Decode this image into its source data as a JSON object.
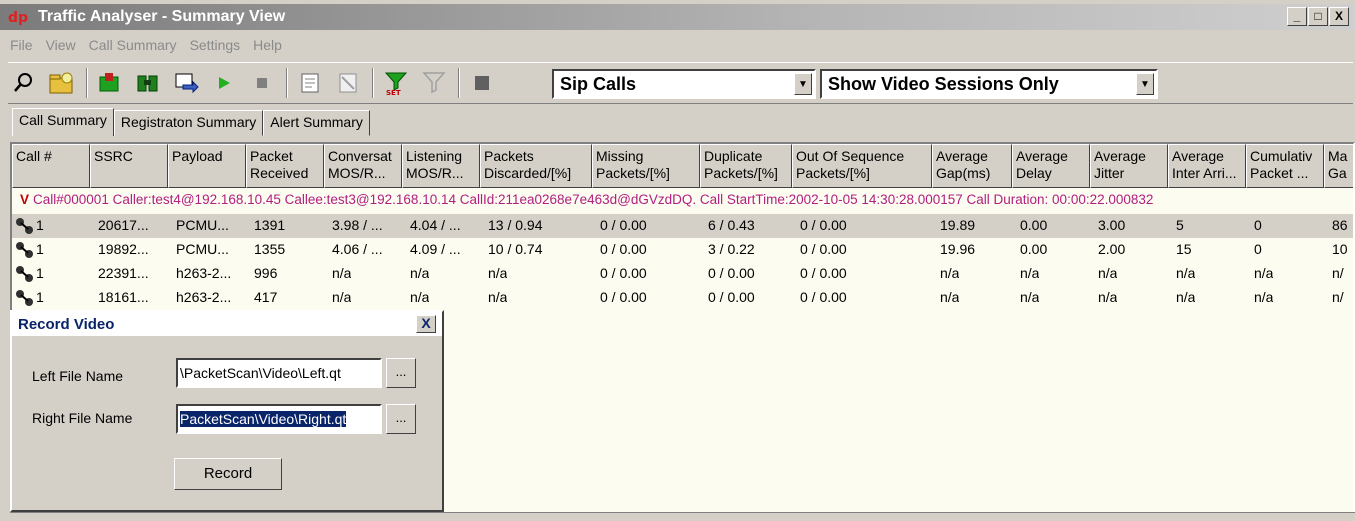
{
  "window": {
    "title": "Traffic Analyser - Summary View",
    "controls": [
      "_",
      "□",
      "X"
    ]
  },
  "menu": [
    "File",
    "View",
    "Call Summary",
    "Settings",
    "Help"
  ],
  "toolbar": {
    "icons": [
      "search-icon",
      "folder-icon",
      "add-icon",
      "binoculars-icon",
      "export-icon",
      "play-icon",
      "stop-icon",
      "report-icon",
      "clear-icon",
      "set-filter-icon",
      "filter-icon",
      "stop-capture-icon"
    ],
    "call_type": "Sip Calls",
    "session_filter": "Show Video Sessions Only"
  },
  "tabs": [
    "Call Summary",
    "Registraton Summary",
    "Alert Summary"
  ],
  "columns": [
    {
      "l1": "Call #",
      "l2": ""
    },
    {
      "l1": "SSRC",
      "l2": ""
    },
    {
      "l1": "Payload",
      "l2": ""
    },
    {
      "l1": "Packet",
      "l2": "Received"
    },
    {
      "l1": "Conversat",
      "l2": "MOS/R..."
    },
    {
      "l1": "Listening",
      "l2": "MOS/R..."
    },
    {
      "l1": "Packets",
      "l2": "Discarded/[%]"
    },
    {
      "l1": "Missing",
      "l2": "Packets/[%]"
    },
    {
      "l1": "Duplicate",
      "l2": "Packets/[%]"
    },
    {
      "l1": "Out Of Sequence",
      "l2": "Packets/[%]"
    },
    {
      "l1": "Average",
      "l2": "Gap(ms)"
    },
    {
      "l1": "Average",
      "l2": "Delay"
    },
    {
      "l1": "Average",
      "l2": "Jitter"
    },
    {
      "l1": "Average",
      "l2": "Inter Arri..."
    },
    {
      "l1": "Cumulativ",
      "l2": "Packet ..."
    },
    {
      "l1": "Ma",
      "l2": "Ga"
    }
  ],
  "call_group": {
    "marker": "V",
    "text": "Call#000001  Caller:test4@192.168.10.45 Callee:test3@192.168.10.14 CallId:211ea0268e7e463d@dGVzdDQ. Call StartTime:2002-10-05 14:30:28.000157 Call Duration: 00:00:22.000832"
  },
  "rows": [
    {
      "call": "1",
      "ssrc": "20617...",
      "payload": "PCMU...",
      "received": "1391",
      "conv": "3.98 / ...",
      "listen": "4.04 / ...",
      "discarded": "13 / 0.94",
      "missing": "0 / 0.00",
      "duplicate": "6 / 0.43",
      "ooseq": "0 / 0.00",
      "gap": "19.89",
      "delay": "0.00",
      "jitter": "3.00",
      "inter": "5",
      "cumul": "0",
      "max": "86"
    },
    {
      "call": "1",
      "ssrc": "19892...",
      "payload": "PCMU...",
      "received": "1355",
      "conv": "4.06 / ...",
      "listen": "4.09 / ...",
      "discarded": "10 / 0.74",
      "missing": "0 / 0.00",
      "duplicate": "3 / 0.22",
      "ooseq": "0 / 0.00",
      "gap": "19.96",
      "delay": "0.00",
      "jitter": "2.00",
      "inter": "15",
      "cumul": "0",
      "max": "10"
    },
    {
      "call": "1",
      "ssrc": "22391...",
      "payload": "h263-2...",
      "received": "996",
      "conv": "n/a",
      "listen": "n/a",
      "discarded": "n/a",
      "missing": "0 / 0.00",
      "duplicate": "0 / 0.00",
      "ooseq": "0 / 0.00",
      "gap": "n/a",
      "delay": "n/a",
      "jitter": "n/a",
      "inter": "n/a",
      "cumul": "n/a",
      "max": "n/"
    },
    {
      "call": "1",
      "ssrc": "18161...",
      "payload": "h263-2...",
      "received": "417",
      "conv": "n/a",
      "listen": "n/a",
      "discarded": "n/a",
      "missing": "0 / 0.00",
      "duplicate": "0 / 0.00",
      "ooseq": "0 / 0.00",
      "gap": "n/a",
      "delay": "n/a",
      "jitter": "n/a",
      "inter": "n/a",
      "cumul": "n/a",
      "max": "n/"
    }
  ],
  "dialog": {
    "title": "Record Video",
    "close": "X",
    "left_label": "Left File Name",
    "left_value": "\\PacketScan\\Video\\Left.qt",
    "right_label": "Right File Name",
    "right_value": "PacketScan\\Video\\Right.qt",
    "browse": "...",
    "record": "Record"
  }
}
